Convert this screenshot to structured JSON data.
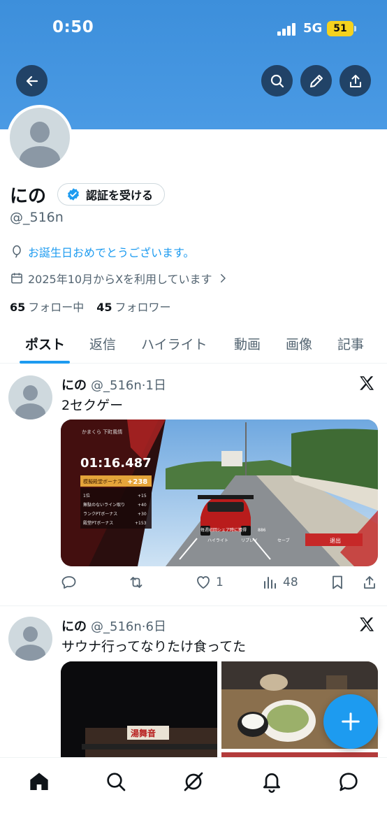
{
  "status_bar": {
    "time": "0:50",
    "network": "5G",
    "battery": "51"
  },
  "profile": {
    "name": "にの",
    "verify_label": "認証を受ける",
    "handle": "@_516n",
    "birthday_text": "お誕生日おめでとうございます。",
    "joined_text": "2025年10月からXを利用しています",
    "following_count": "65",
    "following_label": "フォロー中",
    "followers_count": "45",
    "followers_label": "フォロワー"
  },
  "tabs": [
    {
      "label": "ポスト"
    },
    {
      "label": "返信"
    },
    {
      "label": "ハイライト"
    },
    {
      "label": "動画"
    },
    {
      "label": "画像"
    },
    {
      "label": "記事"
    }
  ],
  "posts": [
    {
      "name": "にの",
      "meta": "@_516n·1日",
      "text": "2セクゲー",
      "replies": "",
      "reposts": "",
      "likes": "1",
      "views": "48",
      "game_ui": {
        "location": "かまくら 下町風情",
        "lap_time": "01:16.487",
        "bonus_title": "模擬殿堂ボーナス",
        "bonus_value": "+238",
        "rows": [
          {
            "label": "1位",
            "value": "+15"
          },
          {
            "label": "無駄のないライン取り",
            "value": "+40"
          },
          {
            "label": "ランクPTボーナス",
            "value": "+30"
          },
          {
            "label": "殿堂PTボーナス",
            "value": "+153"
          }
        ],
        "share_hint": "毎週初回シェア時に獲得",
        "share_value": "886",
        "highlight_label": "ハイライト",
        "replay_label": "リプレイ",
        "save_label": "セーブ",
        "exit_label": "退出"
      }
    },
    {
      "name": "にの",
      "meta": "@_516n·6日",
      "text": "サウナ行ってなりたけ食ってた",
      "sign_text": "湯舞音"
    }
  ],
  "colors": {
    "accent": "#1d9bf0",
    "banner": "#4a9ae4"
  }
}
